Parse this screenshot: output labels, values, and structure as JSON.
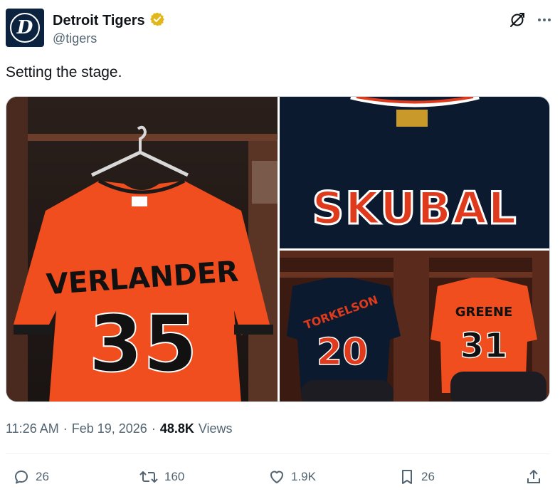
{
  "account": {
    "display_name": "Detroit Tigers",
    "handle": "@tigers",
    "avatar_letter": "D",
    "verified_color": "#e2b719",
    "brand_navy": "#0c2340"
  },
  "tweet": {
    "text": "Setting the stage.",
    "images": [
      {
        "name": "VERLANDER",
        "number": "35",
        "jersey_color": "#f04e1e"
      },
      {
        "name": "SKUBAL",
        "jersey_color": "#0b1a2e"
      },
      {
        "players": [
          {
            "name": "TORKELSON",
            "number": "20"
          },
          {
            "name": "GREENE",
            "number": "31"
          }
        ]
      }
    ]
  },
  "meta": {
    "time": "11:26 AM",
    "separator": "·",
    "date": "Feb 19, 2026",
    "views_count": "48.8K",
    "views_label": "Views"
  },
  "actions": {
    "replies": "26",
    "reposts": "160",
    "likes": "1.9K",
    "bookmarks": "26"
  },
  "icons": [
    "verified-badge-icon",
    "grok-icon",
    "more-icon",
    "reply-icon",
    "repost-icon",
    "like-icon",
    "bookmark-icon",
    "share-icon"
  ]
}
